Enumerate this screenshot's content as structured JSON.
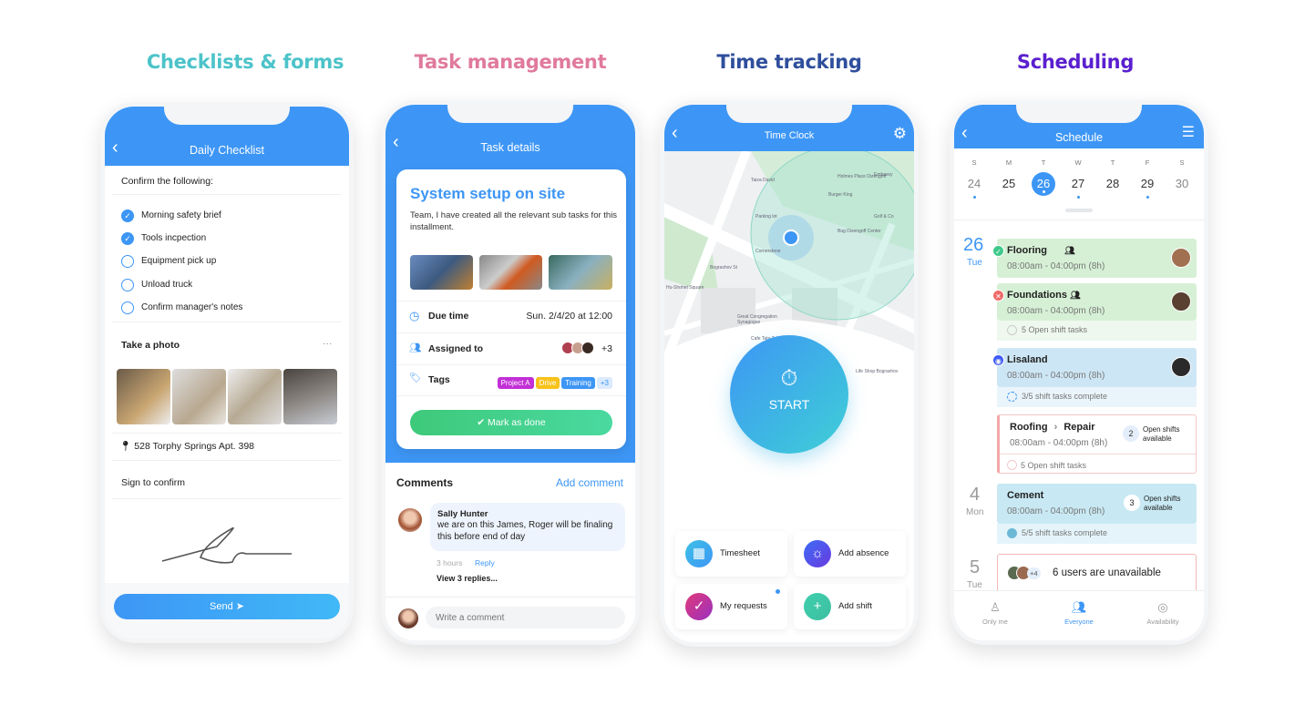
{
  "headings": [
    {
      "label": "Checklists & forms",
      "color": "#4cc3c9"
    },
    {
      "label": "Task management",
      "color": "#e07a9c"
    },
    {
      "label": "Time tracking",
      "color": "#2f4e9c"
    },
    {
      "label": "Scheduling",
      "color": "#5a1fcf"
    }
  ],
  "brand_blue": "#3d96f5",
  "checklist": {
    "title": "Daily Checklist",
    "back_icon": "chevron-left",
    "prompt": "Confirm the following:",
    "items": [
      {
        "label": "Morning safety brief",
        "checked": true
      },
      {
        "label": "Tools incpection",
        "checked": true
      },
      {
        "label": "Equipment pick up",
        "checked": false
      },
      {
        "label": "Unload truck",
        "checked": false
      },
      {
        "label": "Confirm manager's notes",
        "checked": false
      }
    ],
    "photo_label": "Take a photo",
    "more": "···",
    "address": "528 Torphy Springs Apt. 398",
    "sign_label": "Sign to confirm",
    "send": "Send"
  },
  "task": {
    "header": "Task details",
    "title": "System setup on site",
    "description": "Team, I have created all the relevant sub tasks for this installment.",
    "due_label": "Due time",
    "due_value": "Sun. 2/4/20 at 12:00",
    "assigned_label": "Assigned to",
    "assigned_more": "+3",
    "tags_label": "Tags",
    "tags": [
      {
        "label": "Project A",
        "color": "#c22fd6"
      },
      {
        "label": "Drive",
        "color": "#f7c21a"
      },
      {
        "label": "Training",
        "color": "#3d96f5"
      }
    ],
    "tags_more": "+3",
    "done": "Mark as done",
    "comments_label": "Comments",
    "add_comment": "Add comment",
    "comment": {
      "author": "Sally Hunter",
      "text": "we are on this James, Roger will be finaling this before end of day",
      "time": "3 hours",
      "reply": "Reply"
    },
    "view_replies": "View 3 replies...",
    "input_placeholder": "Write a comment"
  },
  "timeclock": {
    "header": "Time Clock",
    "map_labels": [
      "Holmes Place Dizengoff",
      "Burger King",
      "Golf & Co",
      "Bug Dizengoff Center",
      "Taiza David",
      "Parking lot",
      "Cornerstone",
      "Hu-Shohet Square",
      "Great Congregation Synagogue",
      "Cafe Tata Tel Aviv",
      "Life Shop Bograshov",
      "Bograshov St",
      "Embassy"
    ],
    "start": "START",
    "tiles": [
      {
        "label": "Timesheet",
        "color": "#3fb8e8",
        "icon": "calendar"
      },
      {
        "label": "Add absence",
        "color": "#5a4cf0",
        "icon": "sun"
      },
      {
        "label": "My requests",
        "color": "#c23a9a",
        "icon": "check"
      },
      {
        "label": "Add shift",
        "color": "#3ecfae",
        "icon": "plus"
      }
    ]
  },
  "schedule": {
    "header": "Schedule",
    "days": [
      {
        "l": "S",
        "n": "24",
        "dot": true
      },
      {
        "l": "M",
        "n": "25",
        "dot": false
      },
      {
        "l": "T",
        "n": "26",
        "dot": true,
        "selected": true
      },
      {
        "l": "W",
        "n": "27",
        "dot": true
      },
      {
        "l": "T",
        "n": "28",
        "dot": false
      },
      {
        "l": "F",
        "n": "29",
        "dot": true
      },
      {
        "l": "S",
        "n": "30",
        "dot": false
      }
    ],
    "groups": [
      {
        "n": "26",
        "d": "Tue"
      },
      {
        "n": "4",
        "d": "Mon"
      },
      {
        "n": "5",
        "d": "Tue"
      }
    ],
    "shifts": [
      {
        "name": "Flooring",
        "time": "08:00am - 04:00pm (8h)",
        "status": "approved"
      },
      {
        "name": "Foundations",
        "time": "08:00am - 04:00pm (8h)",
        "status": "rejected",
        "sub": "5 Open shift tasks"
      },
      {
        "name": "Lisaland",
        "time": "08:00am - 04:00pm (8h)",
        "status": "in-progress",
        "sub": "3/5 shift tasks complete"
      },
      {
        "name": "Roofing",
        "name2": "Repair",
        "sep": "›",
        "time": "08:00am - 04:00pm (8h)",
        "open_count": "2",
        "open_label": "Open shifts available",
        "sub": "5 Open shift tasks"
      },
      {
        "name": "Cement",
        "time": "08:00am - 04:00pm (8h)",
        "open_count": "3",
        "open_label": "Open shifts available",
        "sub": "5/5 shift tasks complete"
      }
    ],
    "unavailable_more": "+4",
    "unavailable": "6 users are unavailable",
    "nav": [
      {
        "label": "Only me",
        "active": false
      },
      {
        "label": "Everyone",
        "active": true
      },
      {
        "label": "Availability",
        "active": false
      }
    ]
  }
}
